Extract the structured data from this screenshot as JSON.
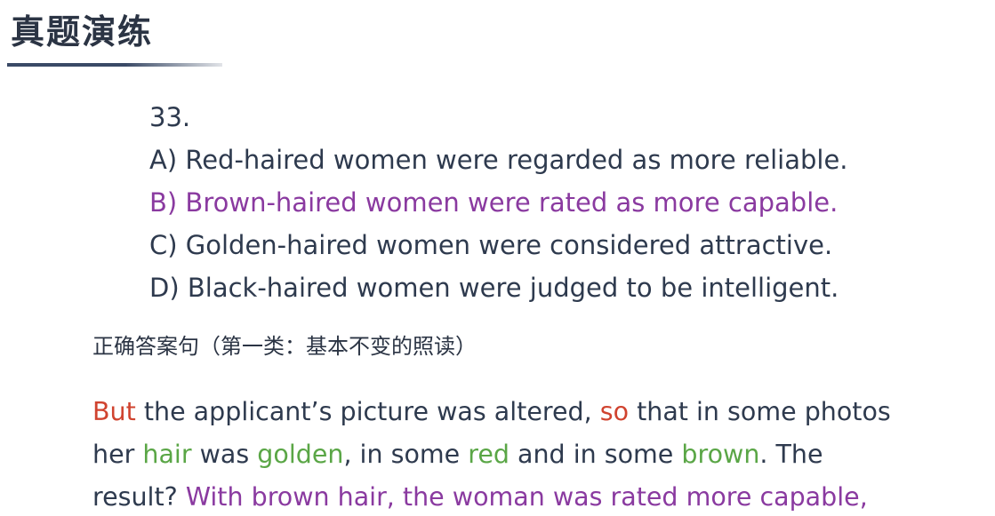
{
  "header": {
    "title": "真题演练"
  },
  "question": {
    "number": "33.",
    "options": [
      {
        "text": "A) Red-haired women were regarded as more reliable."
      },
      {
        "text": "B) Brown-haired women were rated as more capable."
      },
      {
        "text": "C) Golden-haired women were considered attractive."
      },
      {
        "text": "D) Black-haired women were judged to be intelligent."
      }
    ],
    "correct_option": "B",
    "highlight_color": "#8a3aa0"
  },
  "section": {
    "label": "正确答案句（第一类：基本不变的照读）"
  },
  "passage": {
    "line1": {
      "w1": "But",
      "t1": " the applicant’s picture was altered, ",
      "w2": "so",
      "t2": " that in some photos"
    },
    "line2": {
      "t1": "her ",
      "w1": "hair",
      "t2": " was ",
      "w2": "golden",
      "t3": ", in some ",
      "w3": "red",
      "t4": " and in some ",
      "w4": "brown",
      "t5": ". The"
    },
    "line3": {
      "t1": "result? ",
      "w1": "With brown hair, the woman was rated more capable,"
    },
    "colors": {
      "conjunction": "#d0432f",
      "hair_terms": "#5aa646",
      "answer": "#8a3aa0"
    }
  }
}
